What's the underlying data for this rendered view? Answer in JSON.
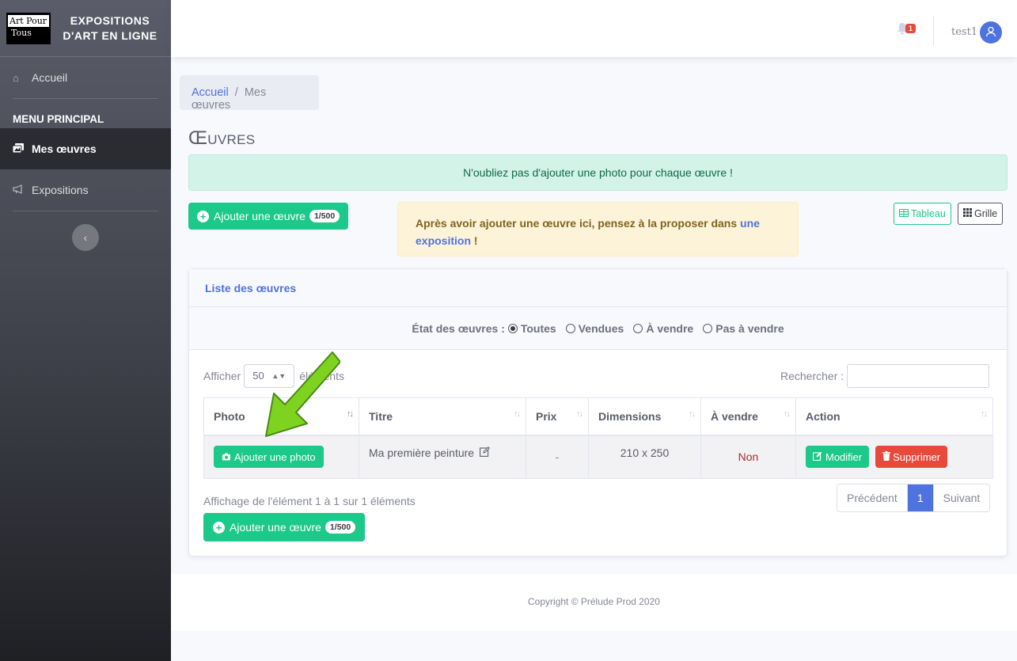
{
  "sidebar": {
    "logo_line1": "Art Pour",
    "logo_line2": "Tous",
    "brand": "EXPOSITIONS D'ART EN LIGNE",
    "home": "Accueil",
    "heading": "MENU PRINCIPAL",
    "items": [
      {
        "label": "Mes œuvres",
        "icon": "images-icon",
        "active": true
      },
      {
        "label": "Expositions",
        "icon": "bullhorn-icon",
        "active": false
      }
    ],
    "toggle_icon": "chevron-left-icon"
  },
  "topbar": {
    "notification_count": "1",
    "user_name": "test1"
  },
  "breadcrumb": {
    "home": "Accueil",
    "separator": "/",
    "current": "Mes œuvres"
  },
  "page": {
    "title": "Œuvres",
    "info_alert": "N'oubliez pas d'ajouter une photo pour chaque œuvre !",
    "add_button": "Ajouter une œuvre",
    "add_badge": "1/500",
    "warn_text": "Après avoir ajouter une œuvre ici, pensez à la proposer dans ",
    "warn_link": "une exposition",
    "warn_end": " !",
    "view_table": "Tableau",
    "view_grid": "Grille"
  },
  "card": {
    "title": "Liste des œuvres",
    "filter_label": "État des œuvres :",
    "filters": [
      "Toutes",
      "Vendues",
      "À vendre",
      "Pas à vendre"
    ],
    "show_prefix": "Afficher",
    "show_value": "50",
    "show_suffix": "éléments",
    "search_label": "Rechercher :",
    "columns": [
      "Photo",
      "Titre",
      "Prix",
      "Dimensions",
      "À vendre",
      "Action"
    ],
    "rows": [
      {
        "photo_button": "Ajouter une photo",
        "title": "Ma première peinture",
        "price": "-",
        "dimensions": "210 x 250",
        "for_sale": "Non",
        "edit": "Modifier",
        "delete": "Supprimer"
      }
    ],
    "info": "Affichage de l'élément 1 à 1 sur 1 éléments",
    "pager": {
      "prev": "Précédent",
      "page": "1",
      "next": "Suivant"
    }
  },
  "footer": "Copyright © Prélude Prod 2020",
  "colors": {
    "primary": "#4e73df",
    "success": "#1cc88a",
    "danger": "#e74a3b",
    "arrow": "#7ed321"
  }
}
